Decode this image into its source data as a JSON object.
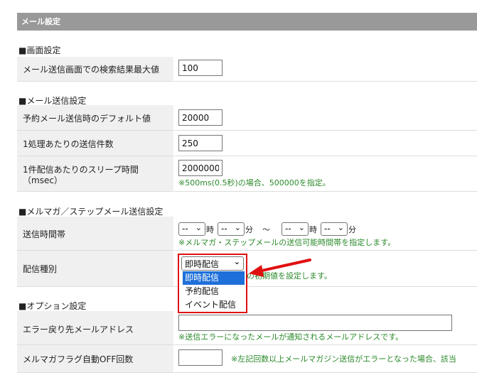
{
  "header": {
    "title": "メール設定"
  },
  "sections": {
    "screen": {
      "title": "■画面設定",
      "rows": [
        {
          "label": "メール送信画面での検索結果最大値",
          "value": "100"
        }
      ]
    },
    "mail": {
      "title": "■メール送信設定",
      "rows": [
        {
          "label": "予約メール送信時のデフォルト値",
          "value": "20000"
        },
        {
          "label": "1処理あたりの送信件数",
          "value": "250"
        },
        {
          "label_line1": "1件配信あたりのスリープ時間",
          "label_line2": "（msec）",
          "value": "2000000",
          "note": "※500ms(0.5秒)の場合、500000を指定。"
        }
      ]
    },
    "magazine": {
      "title": "■メルマガ／ステップメール送信設定",
      "time_row": {
        "label": "送信時間帯",
        "select_placeholder": "--",
        "hour_unit": "時",
        "minute_unit": "分",
        "tilde": "～",
        "note": "※メルマガ・ステップメールの送信可能時間帯を指定します。"
      },
      "type_row": {
        "label": "配信種別",
        "selected": "即時配信",
        "note_visible": "の初期値を設定します。",
        "options": [
          "即時配信",
          "予約配信",
          "イベント配信"
        ]
      }
    },
    "options": {
      "title": "■オプション設定",
      "rows": [
        {
          "label": "エラー戻り先メールアドレス",
          "value": "",
          "note": "※送信エラーになったメールが通知されるメールアドレスです。"
        },
        {
          "label": "メルマガフラグ自動OFF回数",
          "value": "",
          "note": "※左記回数以上メールマガジン送信がエラーとなった場合、該当"
        }
      ]
    }
  },
  "colors": {
    "header_bg": "#999999",
    "label_bg": "#f0f0f0",
    "note_green": "#2b8a2b",
    "highlight_border": "#e01010",
    "selected_option_bg": "#1e6fd9"
  }
}
